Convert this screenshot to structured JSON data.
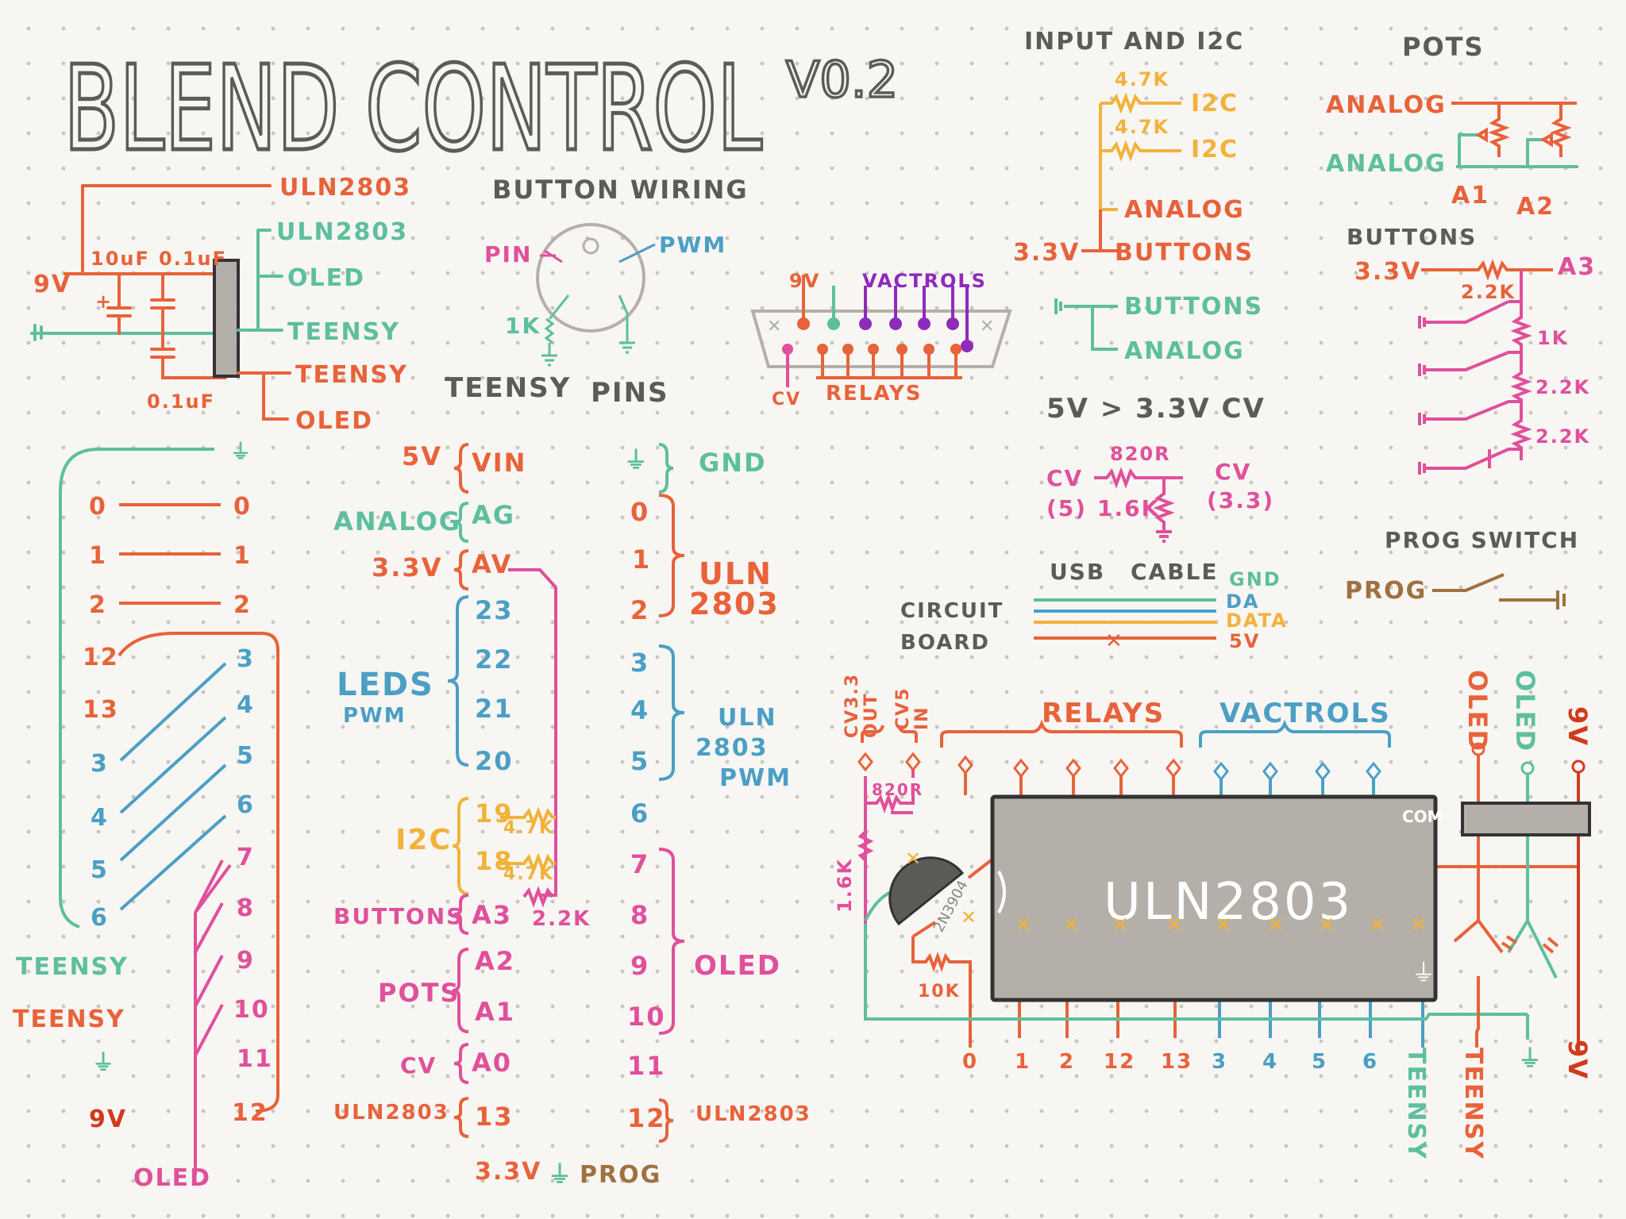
{
  "title": {
    "main": "BLEND CONTROL",
    "version": "V0.2"
  },
  "colors": {
    "orange": "#e8623a",
    "teal": "#5dbf9d",
    "blue": "#4b9fc4",
    "pink": "#e0509b",
    "yellow": "#f2b23a",
    "purple": "#8e2bbb",
    "brown": "#a0703f",
    "gray": "#5b5b57",
    "chip": "#b4b0a9",
    "red": "#cf3b1c"
  },
  "power": {
    "uln_top": "ULN2803",
    "uln_teal": "ULN2803",
    "oled_teal": "OLED",
    "teensy_teal": "TEENSY",
    "teensy_orange": "TEENSY",
    "oled_orange": "OLED",
    "nine_v": "9V",
    "cap1": "10uF",
    "cap2": "0.1uF",
    "cap3": "0.1uF",
    "plus": "+"
  },
  "button_wiring": {
    "title": "BUTTON WIRING",
    "pin": "PIN",
    "pwm": "PWM",
    "r1k": "1K"
  },
  "relay_connector": {
    "nine_v": "9V",
    "vactrols": "VACTROLS",
    "cv": "CV",
    "relays": "RELAYS"
  },
  "input_i2c": {
    "title": "INPUT AND I2C",
    "r1": "4.7K",
    "r2": "4.7K",
    "i2c1": "I2C",
    "i2c2": "I2C",
    "analog": "ANALOG",
    "v33": "3.3V",
    "buttons1": "BUTTONS",
    "buttons2": "BUTTONS",
    "analog2": "ANALOG"
  },
  "pots": {
    "title": "POTS",
    "analog1": "ANALOG",
    "analog2": "ANALOG",
    "a1": "A1",
    "a2": "A2"
  },
  "buttons_ladder": {
    "title": "BUTTONS",
    "v33": "3.3V",
    "a3": "A3",
    "r1": "2.2K",
    "r2": "1K",
    "r3": "2.2K",
    "r4": "2.2K"
  },
  "cv_section": {
    "title": "5V > 3.3V CV",
    "r820": "820R",
    "cv_in": "CV",
    "cv5": "(5)",
    "r16k": "1.6K",
    "cv_out": "CV",
    "cv33": "(3.3)"
  },
  "prog_switch": {
    "title": "PROG SWITCH",
    "prog": "PROG"
  },
  "usb": {
    "title1": "USB",
    "title2": "CABLE",
    "circuit": "CIRCUIT",
    "board": "BOARD",
    "gnd": "GND",
    "da": "DA",
    "data": "DATA",
    "v5": "5V"
  },
  "teensy_pins": {
    "title1": "TEENSY",
    "title2": "PINS",
    "left": [
      {
        "lbl": "5V",
        "pin": "VIN",
        "color": "#e8623a"
      },
      {
        "lbl": "ANALOG",
        "pin": "AG",
        "color": "#5dbf9d"
      },
      {
        "lbl": "3.3V",
        "pin": "AV",
        "color": "#e8623a"
      },
      {
        "pin": "23"
      },
      {
        "pin": "22"
      },
      {
        "pin": "21"
      },
      {
        "pin": "20"
      },
      {
        "pin": "19"
      },
      {
        "pin": "18"
      },
      {
        "lbl": "BUTTONS",
        "pin": "A3",
        "color": "#e0509b"
      },
      {
        "pin": "A2"
      },
      {
        "pin": "A1"
      },
      {
        "lbl": "CV",
        "pin": "A0",
        "color": "#e0509b"
      },
      {
        "lbl": "ULN2803",
        "pin": "13",
        "color": "#e8623a"
      }
    ],
    "leds": "LEDS",
    "pwm": "PWM",
    "i2c": "I2C",
    "r47a": "4.7K",
    "r47b": "4.7K",
    "r22": "2.2K",
    "pots": "POTS",
    "gnd": "GND",
    "right": [
      "0",
      "1",
      "2",
      "3",
      "4",
      "5",
      "6",
      "7",
      "8",
      "9",
      "10",
      "11",
      "12"
    ],
    "uln1": "ULN",
    "uln2": "2803",
    "uln_pwm1": "ULN",
    "uln_pwm2": "2803",
    "uln_pwm3": "PWM",
    "oled": "OLED",
    "uln_bottom": "ULN2803",
    "bottom": {
      "v33": "3.3V",
      "prog": "PROG"
    }
  },
  "connector_map": {
    "left_pins": [
      "0",
      "1",
      "2",
      "12",
      "13",
      "3",
      "4",
      "5",
      "6"
    ],
    "right_pins": [
      "0",
      "1",
      "2",
      "3",
      "4",
      "5",
      "6",
      "7",
      "8",
      "9",
      "10",
      "11",
      "12"
    ],
    "teensy1": "TEENSY",
    "teensy2": "TEENSY",
    "nine_v": "9V",
    "oled": "OLED"
  },
  "board": {
    "chip": "ULN2803",
    "com": "COM",
    "relays": "RELAYS",
    "vactrols": "VACTROLS",
    "cv33_out1": "CV3.3",
    "cv33_out2": "OUT",
    "cv5_in1": "CV5",
    "cv5_in2": "IN",
    "r820": "820R",
    "r16k": "1.6K",
    "r10k": "10K",
    "transistor": "2N3904",
    "oled1": "OLED",
    "oled2": "OLED",
    "nine_v_top": "9V",
    "nine_v_bottom": "9V",
    "bottom_pins": [
      "0",
      "1",
      "2",
      "12",
      "13",
      "3",
      "4",
      "5",
      "6"
    ],
    "teensy_teal": "TEENSY",
    "teensy_orange": "TEENSY"
  }
}
